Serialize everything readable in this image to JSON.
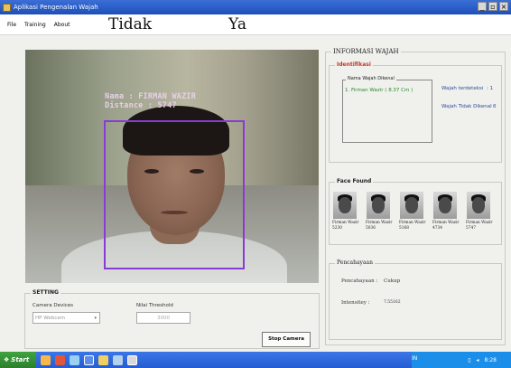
{
  "window": {
    "title": "Aplikasi Pengenalan Wajah"
  },
  "menu": [
    "File",
    "Training",
    "About"
  ],
  "overlay_labels": {
    "left": "Tidak",
    "right": "Ya"
  },
  "camera": {
    "name_line": "Nama : FIRMAN WAZIR",
    "distance_line": "Distance : 5747",
    "box_color": "#8a3ad6"
  },
  "setting": {
    "title": "SETTING",
    "camera_devices_label": "Camera Devices",
    "camera_device_value": "HP Webcam",
    "threshold_label": "Nilai Threshold",
    "threshold_value": "3000",
    "stop_button": "Stop Camera"
  },
  "info": {
    "title": "INFORMASI WAJAH",
    "identification": {
      "title": "Identifikasi",
      "list_title": "Nama Wajah Dikenal",
      "list_items": [
        "1. Firman Wazir ( 8.37 Cm )"
      ],
      "detected_label": "Wajah terdeteksi",
      "detected_value": ": 1",
      "unknown_label": "Wajah Tidak Dikenal :",
      "unknown_value": "0"
    },
    "face_found": {
      "title": "Face Found",
      "faces": [
        {
          "name": "Firman Wazir",
          "value": "5230"
        },
        {
          "name": "Firman Wazir",
          "value": "5036"
        },
        {
          "name": "Firman Wazir",
          "value": "5168"
        },
        {
          "name": "Firman Wazir",
          "value": "4734"
        },
        {
          "name": "Firman Wazir",
          "value": "5747"
        }
      ]
    },
    "lighting": {
      "title": "Pencahayaan",
      "label": "Pencahayaan :",
      "value": "Cukup",
      "intensity_label": "Intensitey :",
      "intensity_value": "7.55162"
    }
  },
  "taskbar": {
    "start": "Start",
    "lang": "IN",
    "time": "8:28"
  }
}
